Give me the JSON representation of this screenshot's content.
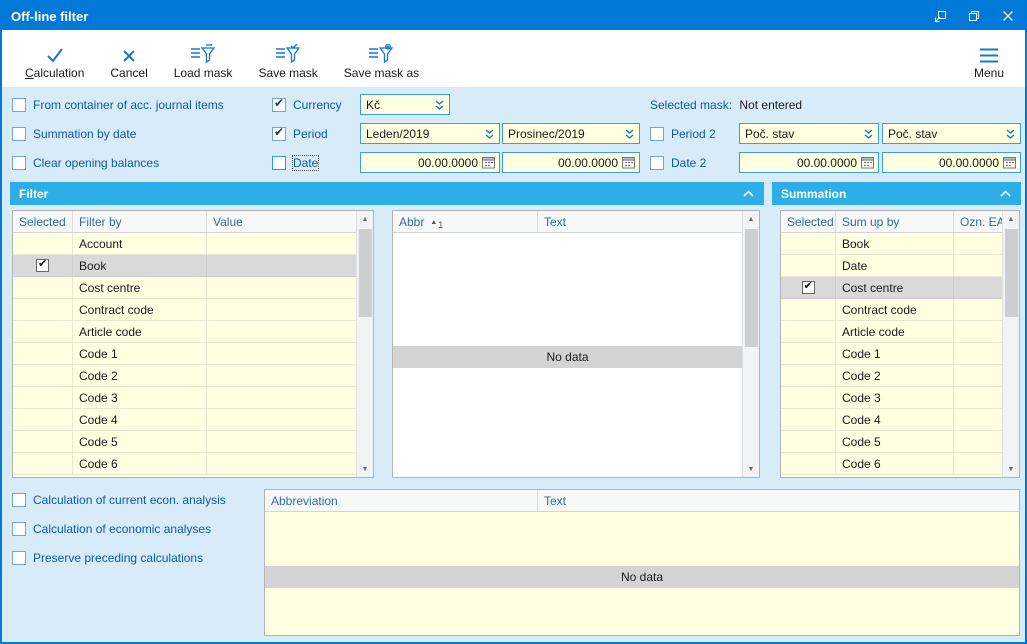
{
  "window": {
    "title": "Off-line filter"
  },
  "toolbar": {
    "calculation": "Calculation",
    "cancel": "Cancel",
    "load_mask": "Load mask",
    "save_mask": "Save mask",
    "save_mask_as": "Save mask as",
    "menu": "Menu"
  },
  "options": {
    "from_container": {
      "label": "From container of acc. journal items",
      "checked": false
    },
    "summation_by_date": {
      "label": "Summation by date",
      "checked": false
    },
    "clear_opening": {
      "label": "Clear opening balances",
      "checked": false
    },
    "currency": {
      "label": "Currency",
      "checked": true,
      "value": "Kč"
    },
    "period": {
      "label": "Period",
      "checked": true,
      "from": "Leden/2019",
      "to": "Prosinec/2019"
    },
    "date": {
      "label": "Date",
      "checked": false,
      "from": "00.00.0000",
      "to": "00.00.0000"
    },
    "selected_mask": {
      "label": "Selected mask:",
      "value": "Not entered"
    },
    "period2": {
      "label": "Period 2",
      "checked": false,
      "from": "Poč. stav",
      "to": "Poč. stav"
    },
    "date2": {
      "label": "Date 2",
      "checked": false,
      "from": "00.00.0000",
      "to": "00.00.0000"
    }
  },
  "filter": {
    "title": "Filter",
    "columns": [
      "Selected",
      "Filter by",
      "Value"
    ],
    "rows": [
      {
        "selected": false,
        "highlighted": false,
        "label": "Account",
        "value": ""
      },
      {
        "selected": true,
        "highlighted": true,
        "label": "Book",
        "value": ""
      },
      {
        "selected": false,
        "highlighted": false,
        "label": "Cost centre",
        "value": ""
      },
      {
        "selected": false,
        "highlighted": false,
        "label": "Contract code",
        "value": ""
      },
      {
        "selected": false,
        "highlighted": false,
        "label": "Article code",
        "value": ""
      },
      {
        "selected": false,
        "highlighted": false,
        "label": "Code 1",
        "value": ""
      },
      {
        "selected": false,
        "highlighted": false,
        "label": "Code 2",
        "value": ""
      },
      {
        "selected": false,
        "highlighted": false,
        "label": "Code 3",
        "value": ""
      },
      {
        "selected": false,
        "highlighted": false,
        "label": "Code 4",
        "value": ""
      },
      {
        "selected": false,
        "highlighted": false,
        "label": "Code 5",
        "value": ""
      },
      {
        "selected": false,
        "highlighted": false,
        "label": "Code 6",
        "value": ""
      }
    ]
  },
  "abbr_table": {
    "columns": [
      "Abbr",
      "Text"
    ],
    "sort_order": "1",
    "empty_text": "No data"
  },
  "summation": {
    "title": "Summation",
    "columns": [
      "Selected",
      "Sum up by",
      "Ozn. EA"
    ],
    "rows": [
      {
        "selected": false,
        "highlighted": false,
        "label": "Book",
        "value": ""
      },
      {
        "selected": false,
        "highlighted": false,
        "label": "Date",
        "value": ""
      },
      {
        "selected": true,
        "highlighted": true,
        "label": "Cost centre",
        "value": ""
      },
      {
        "selected": false,
        "highlighted": false,
        "label": "Contract code",
        "value": ""
      },
      {
        "selected": false,
        "highlighted": false,
        "label": "Article code",
        "value": ""
      },
      {
        "selected": false,
        "highlighted": false,
        "label": "Code 1",
        "value": ""
      },
      {
        "selected": false,
        "highlighted": false,
        "label": "Code 2",
        "value": ""
      },
      {
        "selected": false,
        "highlighted": false,
        "label": "Code 3",
        "value": ""
      },
      {
        "selected": false,
        "highlighted": false,
        "label": "Code 4",
        "value": ""
      },
      {
        "selected": false,
        "highlighted": false,
        "label": "Code 5",
        "value": ""
      },
      {
        "selected": false,
        "highlighted": false,
        "label": "Code 6",
        "value": ""
      }
    ]
  },
  "bottom": {
    "checkboxes": [
      {
        "label": "Calculation of current econ. analysis",
        "checked": false
      },
      {
        "label": "Calculation of economic analyses",
        "checked": false
      },
      {
        "label": "Preserve preceding calculations",
        "checked": false
      }
    ],
    "table": {
      "columns": [
        "Abbreviation",
        "Text"
      ],
      "empty_text": "No data"
    }
  }
}
